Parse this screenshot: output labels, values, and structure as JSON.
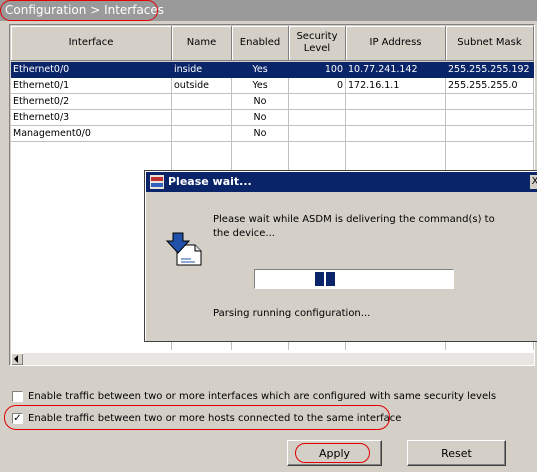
{
  "breadcrumb": {
    "text": "Configuration > Interfaces",
    "highlight_color": "#e00000"
  },
  "table": {
    "columns": [
      "Interface",
      "Name",
      "Enabled",
      "Security Level",
      "IP Address",
      "Subnet Mask"
    ],
    "rows": [
      {
        "interface": "Ethernet0/0",
        "name": "inside",
        "enabled": "Yes",
        "security_level": "100",
        "ip": "10.77.241.142",
        "mask": "255.255.255.192",
        "selected": true
      },
      {
        "interface": "Ethernet0/1",
        "name": "outside",
        "enabled": "Yes",
        "security_level": "0",
        "ip": "172.16.1.1",
        "mask": "255.255.255.0",
        "selected": false
      },
      {
        "interface": "Ethernet0/2",
        "name": "",
        "enabled": "No",
        "security_level": "",
        "ip": "",
        "mask": "",
        "selected": false
      },
      {
        "interface": "Ethernet0/3",
        "name": "",
        "enabled": "No",
        "security_level": "",
        "ip": "",
        "mask": "",
        "selected": false
      },
      {
        "interface": "Management0/0",
        "name": "",
        "enabled": "No",
        "security_level": "",
        "ip": "",
        "mask": "",
        "selected": false
      }
    ],
    "selection_color": "#0a246a"
  },
  "dialog": {
    "title": "Please wait...",
    "close_label": "X",
    "message": "Please wait while ASDM is delivering the command(s) to the device...",
    "status": "Parsing running configuration...",
    "icon": "document-download-icon"
  },
  "options": {
    "same_security": {
      "label": "Enable traffic between two or more interfaces which are configured with same security levels",
      "checked": false
    },
    "same_interface": {
      "label": "Enable traffic between two or more hosts connected to the same interface",
      "checked": true,
      "check_mark": "✓"
    }
  },
  "buttons": {
    "apply": "Apply",
    "reset": "Reset"
  }
}
